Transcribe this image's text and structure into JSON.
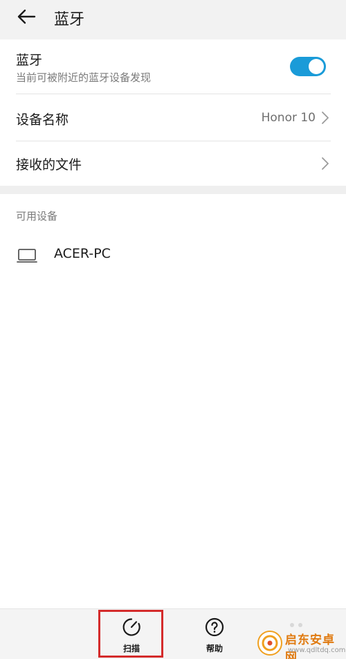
{
  "header": {
    "title": "蓝牙",
    "back_icon": "arrow-left-icon"
  },
  "bluetooth": {
    "label": "蓝牙",
    "subtitle": "当前可被附近的蓝牙设备发现",
    "enabled": true,
    "accent": "#1a9bd8"
  },
  "device_name": {
    "label": "设备名称",
    "value": "Honor 10"
  },
  "received_files": {
    "label": "接收的文件"
  },
  "available": {
    "title": "可用设备",
    "devices": [
      {
        "name": "ACER-PC",
        "icon": "laptop-icon"
      }
    ]
  },
  "bottom_bar": {
    "items": [
      {
        "label": "扫描",
        "icon": "scan-icon"
      },
      {
        "label": "帮助",
        "icon": "help-icon"
      }
    ],
    "highlight_color": "#d42b2b"
  },
  "watermark": {
    "brand": "启东安卓网",
    "url": "www.qdltdq.com"
  }
}
